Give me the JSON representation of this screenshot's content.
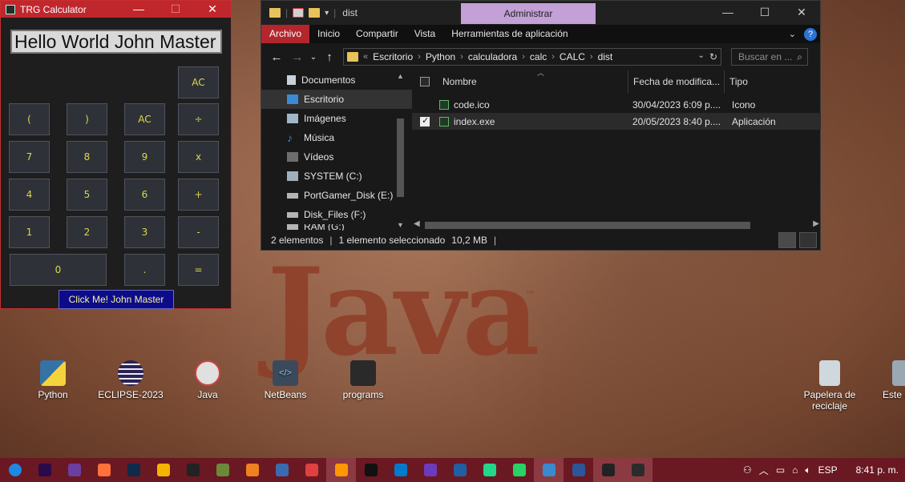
{
  "calculator": {
    "title": "TRG Calculator",
    "window_controls": [
      "—",
      "☐",
      "✕"
    ],
    "display": "Hello World John Master",
    "buttons": {
      "ac_top": "AC",
      "lparen": "(",
      "rparen": ")",
      "ac": "AC",
      "div": "÷",
      "n7": "7",
      "n8": "8",
      "n9": "9",
      "mul": "x",
      "n4": "4",
      "n5": "5",
      "n6": "6",
      "add": "+",
      "n1": "1",
      "n2": "2",
      "n3": "3",
      "sub": "-",
      "n0": "0",
      "dot": ".",
      "eq": "="
    },
    "click_me": "Click Me! John Master"
  },
  "explorer": {
    "title_path": "dist",
    "context_tab": "Administrar",
    "window_controls": [
      "—",
      "☐",
      "✕"
    ],
    "ribbon_tabs": [
      "Archivo",
      "Inicio",
      "Compartir",
      "Vista",
      "Herramientas de aplicación"
    ],
    "address": {
      "crumbs": [
        "Escritorio",
        "Python",
        "calculadora",
        "calc",
        "CALC",
        "dist"
      ]
    },
    "search_placeholder": "Buscar en ...",
    "nav_items": [
      {
        "label": "Documentos",
        "icon": "documents-icon"
      },
      {
        "label": "Escritorio",
        "icon": "desktop-icon",
        "selected": true
      },
      {
        "label": "Imágenes",
        "icon": "pictures-icon"
      },
      {
        "label": "Música",
        "icon": "music-icon"
      },
      {
        "label": "Vídeos",
        "icon": "videos-icon"
      },
      {
        "label": "SYSTEM (C:)",
        "icon": "drive-c-icon"
      },
      {
        "label": "PortGamer_Disk (E:)",
        "icon": "drive-icon"
      },
      {
        "label": "Disk_Files (F:)",
        "icon": "drive-icon"
      },
      {
        "label": "RAM (G:)",
        "icon": "drive-icon"
      }
    ],
    "columns": [
      "Nombre",
      "Fecha de modifica...",
      "Tipo"
    ],
    "files": [
      {
        "name": "code.ico",
        "date": "30/04/2023 6:09 p....",
        "type": "Icono",
        "selected": false
      },
      {
        "name": "index.exe",
        "date": "20/05/2023 8:40 p....",
        "type": "Aplicación",
        "selected": true
      }
    ],
    "status": {
      "count": "2 elementos",
      "selection": "1 elemento seleccionado",
      "size": "10,2 MB"
    }
  },
  "desktop": {
    "wallpaper_text": "Java",
    "wallpaper_tm": "™",
    "icons": [
      {
        "label": "Python",
        "color": "#3572A5"
      },
      {
        "label": "ECLIPSE-2023",
        "color": "#2c2255"
      },
      {
        "label": "Java",
        "color": "#e0e0e0"
      },
      {
        "label": "NetBeans",
        "color": "#3b4a5a"
      },
      {
        "label": "programs",
        "color": "#2a2a2a"
      },
      {
        "label": "Papelera de reciclaje",
        "color": "#cfd8dc"
      },
      {
        "label": "Este e"
      }
    ]
  },
  "taskbar": {
    "apps": [
      {
        "name": "windows-start-icon",
        "color": "#1e88e5"
      },
      {
        "name": "after-effects-icon",
        "color": "#2a0a4a"
      },
      {
        "name": "video-editor-icon",
        "color": "#6b3fa0"
      },
      {
        "name": "firefox-icon",
        "color": "#ff7139"
      },
      {
        "name": "photoshop-icon",
        "color": "#0f2a4a"
      },
      {
        "name": "chrome-icon",
        "color": "#f4b400"
      },
      {
        "name": "unity-icon",
        "color": "#222222"
      },
      {
        "name": "krita-icon",
        "color": "#6a8a3a"
      },
      {
        "name": "blender-icon",
        "color": "#f08020"
      },
      {
        "name": "calendar-icon",
        "color": "#3a6ab0"
      },
      {
        "name": "game-icon",
        "color": "#e04040"
      },
      {
        "name": "sublime-icon",
        "color": "#ff9800"
      },
      {
        "name": "webstorm-icon",
        "color": "#111111"
      },
      {
        "name": "vscode-icon",
        "color": "#007acc"
      },
      {
        "name": "visual-studio-icon",
        "color": "#6c3bbd"
      },
      {
        "name": "virtualbox-icon",
        "color": "#2060a0"
      },
      {
        "name": "pycharm-icon",
        "color": "#21d789"
      },
      {
        "name": "whatsapp-icon",
        "color": "#25d366"
      },
      {
        "name": "screen-recorder-icon",
        "color": "#3a8ad0"
      },
      {
        "name": "word-icon",
        "color": "#2b579a"
      },
      {
        "name": "terminal-icon",
        "color": "#222222"
      },
      {
        "name": "calculator-app-icon",
        "color": "#2b2b2b"
      }
    ],
    "tray": {
      "language": "ESP",
      "time": "8:41 p. m."
    }
  }
}
